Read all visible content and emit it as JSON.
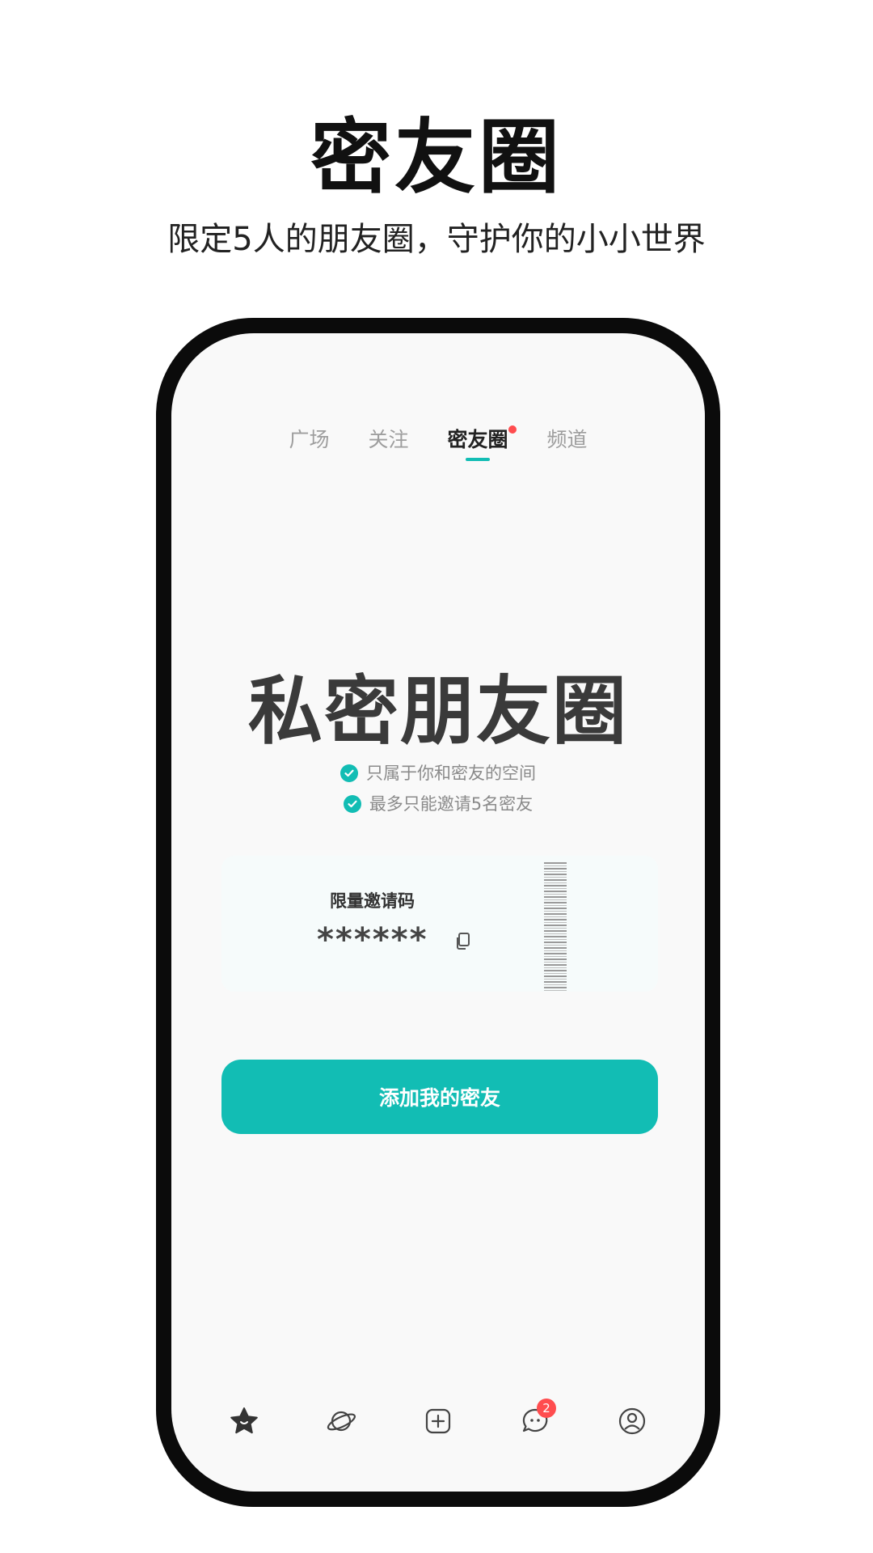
{
  "promo": {
    "title": "密友圈",
    "subtitle": "限定5人的朋友圈，守护你的小小世界"
  },
  "tabs": [
    {
      "label": "广场",
      "active": false
    },
    {
      "label": "关注",
      "active": false
    },
    {
      "label": "密友圈",
      "active": true,
      "has_dot": true
    },
    {
      "label": "频道",
      "active": false
    }
  ],
  "hero": {
    "title": "私密朋友圈",
    "features": [
      "只属于你和密友的空间",
      "最多只能邀请5名密友"
    ]
  },
  "invite": {
    "label": "限量邀请码",
    "code": "******"
  },
  "primary_button": {
    "label": "添加我的密友"
  },
  "bottom_nav": {
    "items": [
      {
        "icon": "star-home-icon"
      },
      {
        "icon": "planet-icon"
      },
      {
        "icon": "plus-square-icon"
      },
      {
        "icon": "message-bubble-icon",
        "badge": "2"
      },
      {
        "icon": "profile-icon"
      }
    ]
  },
  "colors": {
    "accent": "#12bdb4",
    "badge": "#ff4d4f",
    "phone_frame": "#0b0b0b",
    "screen_bg": "#f9f9f9"
  }
}
